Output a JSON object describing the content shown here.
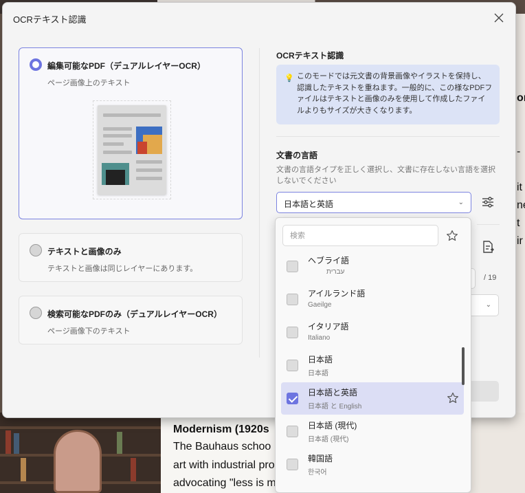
{
  "dialog": {
    "title": "OCRテキスト認識"
  },
  "options": [
    {
      "title": "編集可能なPDF（デュアルレイヤーOCR）",
      "subtitle": "ページ画像上のテキスト",
      "selected": true
    },
    {
      "title": "テキストと画像のみ",
      "subtitle": "テキストと画像は同じレイヤーにあります。",
      "selected": false
    },
    {
      "title": "検索可能なPDFのみ（デュアルレイヤーOCR）",
      "subtitle": "ページ画像下のテキスト",
      "selected": false
    }
  ],
  "right_panel": {
    "heading": "OCRテキスト認識",
    "info_text": "このモードでは元文書の背景画像やイラストを保持し、認識したテキストを重ねます。一般的に、この様なPDFファイルはテキストと画像のみを使用して作成したファイルよりもサイズが大きくなります。",
    "language_label": "文書の言語",
    "language_desc": "文書の言語タイプを正しく選択し、文書に存在しない言語を選択しないでください",
    "language_value": "日本語と英語",
    "page_total": "/ 19"
  },
  "dropdown": {
    "search_placeholder": "検索",
    "items": [
      {
        "name": "ヘブライ語",
        "native": "עברית",
        "checked": false
      },
      {
        "name": "アイルランド語",
        "native": "Gaeilge",
        "checked": false
      },
      {
        "name": "イタリア語",
        "native": "Italiano",
        "checked": false
      },
      {
        "name": "日本語",
        "native": "日本語",
        "checked": false
      },
      {
        "name": "日本語と英語",
        "native": "日本語 と English",
        "checked": true
      },
      {
        "name": "日本語 (現代)",
        "native": "日本語 (現代)",
        "checked": false
      },
      {
        "name": "韓国語",
        "native": "한국어",
        "checked": false
      }
    ]
  },
  "background": {
    "heading": "Modernism (1920s",
    "lines": [
      "The Bauhaus schoo",
      "art with industrial pro",
      "advocating \"less is m"
    ],
    "right_fragments": [
      "or",
      "-",
      "it",
      "ne",
      "t",
      "ir"
    ]
  },
  "colors": {
    "accent": "#6d74e0",
    "info_bg": "#dce3f6",
    "selected_item_bg": "#dcdef5"
  }
}
